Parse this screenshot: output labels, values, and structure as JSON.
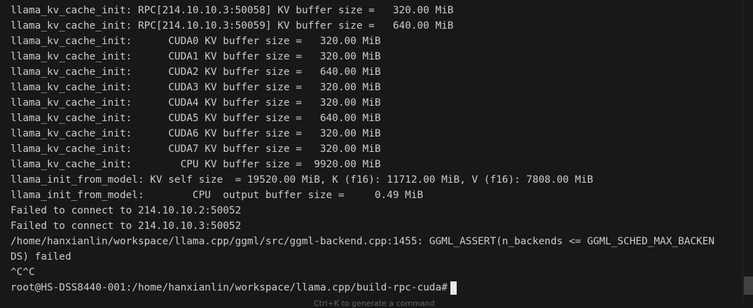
{
  "terminal": {
    "lines": [
      "llama_kv_cache_init: RPC[214.10.10.3:50058] KV buffer size =   320.00 MiB",
      "llama_kv_cache_init: RPC[214.10.10.3:50059] KV buffer size =   640.00 MiB",
      "llama_kv_cache_init:      CUDA0 KV buffer size =   320.00 MiB",
      "llama_kv_cache_init:      CUDA1 KV buffer size =   320.00 MiB",
      "llama_kv_cache_init:      CUDA2 KV buffer size =   640.00 MiB",
      "llama_kv_cache_init:      CUDA3 KV buffer size =   320.00 MiB",
      "llama_kv_cache_init:      CUDA4 KV buffer size =   320.00 MiB",
      "llama_kv_cache_init:      CUDA5 KV buffer size =   640.00 MiB",
      "llama_kv_cache_init:      CUDA6 KV buffer size =   320.00 MiB",
      "llama_kv_cache_init:      CUDA7 KV buffer size =   320.00 MiB",
      "llama_kv_cache_init:        CPU KV buffer size =  9920.00 MiB",
      "llama_init_from_model: KV self size  = 19520.00 MiB, K (f16): 11712.00 MiB, V (f16): 7808.00 MiB",
      "llama_init_from_model:        CPU  output buffer size =     0.49 MiB",
      "Failed to connect to 214.10.10.2:50052",
      "Failed to connect to 214.10.10.3:50052",
      "/home/hanxianlin/workspace/llama.cpp/ggml/src/ggml-backend.cpp:1455: GGML_ASSERT(n_backends <= GGML_SCHED_MAX_BACKEN",
      "DS) failed",
      "^C^C"
    ],
    "prompt": "root@HS-DSS8440-001:/home/hanxianlin/workspace/llama.cpp/build-rpc-cuda#",
    "hint": "Ctrl+K to generate a command"
  },
  "colors": {
    "background": "#181818",
    "text": "#cccccc",
    "cursor": "#e8e8e8"
  }
}
